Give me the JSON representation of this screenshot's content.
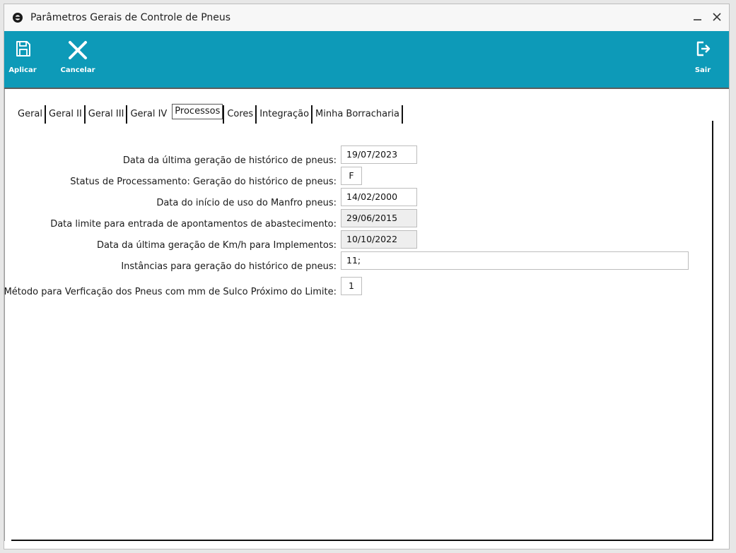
{
  "window": {
    "title": "Parâmetros Gerais de Controle de Pneus",
    "accent_color": "#0d9ab8"
  },
  "toolbar": {
    "aplicar_label": "Aplicar",
    "cancelar_label": "Cancelar",
    "sair_label": "Sair"
  },
  "tabs": [
    {
      "label": "Geral"
    },
    {
      "label": "Geral II"
    },
    {
      "label": "Geral III"
    },
    {
      "label": "Geral IV"
    },
    {
      "label": "Processos",
      "active": true
    },
    {
      "label": "Cores"
    },
    {
      "label": "Integração"
    },
    {
      "label": "Minha Borracharia"
    }
  ],
  "form": {
    "rows": [
      {
        "label": "Data da última geração de histórico de pneus:",
        "value": "19/07/2023",
        "readonly": false
      },
      {
        "label": "Status de Processamento: Geração do histórico de pneus:",
        "value": "F",
        "readonly": false
      },
      {
        "label": "Data do início de uso do Manfro pneus:",
        "value": "14/02/2000",
        "readonly": false
      },
      {
        "label": "Data limite para entrada de apontamentos de abastecimento:",
        "value": "29/06/2015",
        "readonly": true
      },
      {
        "label": "Data da última geração de Km/h para Implementos:",
        "value": "10/10/2022",
        "readonly": true
      },
      {
        "label": "Instâncias para geração do histórico de pneus:",
        "value": "11;",
        "readonly": false
      },
      {
        "label": "Método para Verficação dos Pneus com mm de Sulco Próximo do Limite:",
        "value": "1",
        "readonly": false
      }
    ]
  }
}
